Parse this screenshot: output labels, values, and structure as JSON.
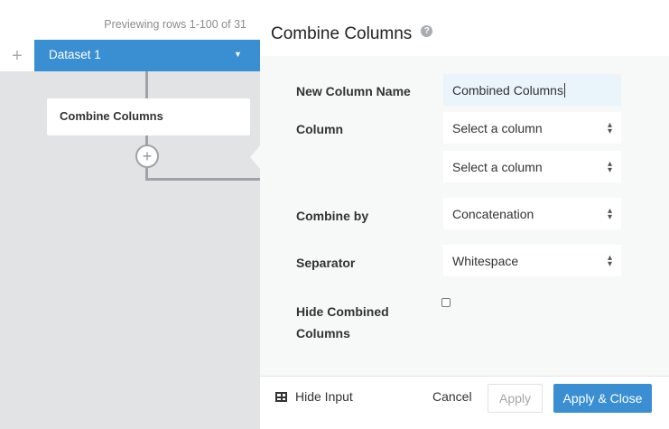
{
  "left": {
    "preview_text": "Previewing rows 1-100 of 31",
    "dataset_name": "Dataset 1",
    "add_dataset_glyph": "+",
    "dataset_caret": "▼",
    "step_name": "Combine Columns",
    "add_step_glyph": "+"
  },
  "panel": {
    "title": "Combine Columns",
    "help_glyph": "?",
    "fields": {
      "new_column_name_label": "New Column Name",
      "new_column_name_value": "Combined Columns",
      "column_label": "Column",
      "column_1_value": "Select a column",
      "column_2_value": "Select a column",
      "combine_by_label": "Combine by",
      "combine_by_value": "Concatenation",
      "separator_label": "Separator",
      "separator_value": "Whitespace",
      "hide_combined_label_line1": "Hide Combined",
      "hide_combined_label_line2": "Columns",
      "hide_combined_checked": false
    }
  },
  "footer": {
    "hide_input_label": "Hide Input",
    "cancel_label": "Cancel",
    "apply_label": "Apply",
    "apply_close_label": "Apply & Close"
  },
  "icons": {
    "help": "help-circle-icon",
    "select_arrows": "up-down-arrows-icon",
    "table": "table-icon",
    "add": "plus-icon"
  },
  "colors": {
    "accent": "#3a8fd3",
    "left_background": "#e2e3e5",
    "form_background": "#f7f8f8",
    "input_highlight": "#eaf4fb"
  }
}
